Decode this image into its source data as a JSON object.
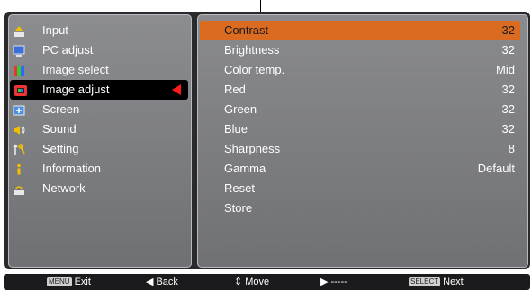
{
  "sidebar": {
    "items": [
      {
        "label": "Input",
        "icon": "input-icon"
      },
      {
        "label": "PC adjust",
        "icon": "pc-adjust-icon"
      },
      {
        "label": "Image select",
        "icon": "image-select-icon"
      },
      {
        "label": "Image adjust",
        "icon": "image-adjust-icon",
        "selected": true
      },
      {
        "label": "Screen",
        "icon": "screen-icon"
      },
      {
        "label": "Sound",
        "icon": "sound-icon"
      },
      {
        "label": "Setting",
        "icon": "setting-icon"
      },
      {
        "label": "Information",
        "icon": "information-icon"
      },
      {
        "label": "Network",
        "icon": "network-icon"
      }
    ]
  },
  "settings": {
    "rows": [
      {
        "label": "Contrast",
        "value": "32",
        "selected": true
      },
      {
        "label": "Brightness",
        "value": "32"
      },
      {
        "label": "Color temp.",
        "value": "Mid"
      },
      {
        "label": "Red",
        "value": "32"
      },
      {
        "label": "Green",
        "value": "32"
      },
      {
        "label": "Blue",
        "value": "32"
      },
      {
        "label": "Sharpness",
        "value": "8"
      },
      {
        "label": "Gamma",
        "value": "Default"
      },
      {
        "label": "Reset",
        "value": ""
      },
      {
        "label": "Store",
        "value": ""
      }
    ]
  },
  "statusbar": {
    "exit_key": "MENU",
    "exit_label": "Exit",
    "back_glyph": "◀",
    "back_label": "Back",
    "move_glyph": "⇕",
    "move_label": "Move",
    "next_glyph": "▶",
    "next_label": "-----",
    "select_key": "SELECT",
    "select_label": "Next"
  },
  "colors": {
    "highlight": "#dc6b22",
    "selection_arrow": "#ff1a1a",
    "panel": "#7d7e82"
  }
}
